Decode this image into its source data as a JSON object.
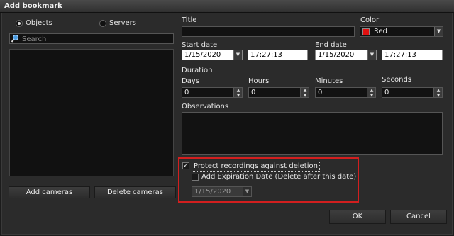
{
  "window": {
    "title": "Add bookmark"
  },
  "sources": {
    "objects_label": "Objects",
    "servers_label": "Servers",
    "search_placeholder": "Search",
    "add_cameras_label": "Add cameras",
    "delete_cameras_label": "Delete cameras"
  },
  "form": {
    "title_label": "Title",
    "title_value": "",
    "color_label": "Color",
    "color_value": "Red",
    "color_swatch": "#e01010",
    "start_date_label": "Start date",
    "start_date_value": "1/15/2020",
    "start_time_value": "17:27:13",
    "end_date_label": "End date",
    "end_date_value": "1/15/2020",
    "end_time_value": "17:27:13",
    "duration_label": "Duration",
    "days_label": "Days",
    "days_value": "0",
    "hours_label": "Hours",
    "hours_value": "0",
    "minutes_label": "Minutes",
    "minutes_value": "0",
    "seconds_label": "Seconds",
    "seconds_value": "0",
    "observations_label": "Observations",
    "observations_value": ""
  },
  "protection": {
    "protect_label": "Protect recordings against deletion",
    "protect_checked": true,
    "expiration_label": "Add Expiration Date (Delete after this date)",
    "expiration_checked": false,
    "expiration_date_value": "1/15/2020",
    "highlight_color": "#d21f1f"
  },
  "footer": {
    "ok_label": "OK",
    "cancel_label": "Cancel"
  }
}
